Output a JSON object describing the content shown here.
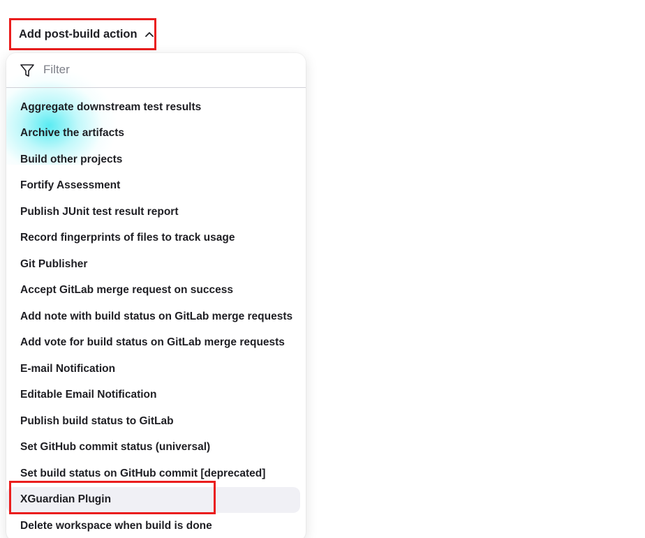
{
  "add_button": {
    "label": "Add post-build action",
    "icon": "chevron-up-icon"
  },
  "filter": {
    "placeholder": "Filter",
    "value": "",
    "icon": "filter-funnel-icon"
  },
  "menu_items": [
    {
      "label": "Aggregate downstream test results"
    },
    {
      "label": "Archive the artifacts"
    },
    {
      "label": "Build other projects"
    },
    {
      "label": "Fortify Assessment"
    },
    {
      "label": "Publish JUnit test result report"
    },
    {
      "label": "Record fingerprints of files to track usage"
    },
    {
      "label": "Git Publisher"
    },
    {
      "label": "Accept GitLab merge request on success"
    },
    {
      "label": "Add note with build status on GitLab merge requests"
    },
    {
      "label": "Add vote for build status on GitLab merge requests"
    },
    {
      "label": "E-mail Notification"
    },
    {
      "label": "Editable Email Notification"
    },
    {
      "label": "Publish build status to GitLab"
    },
    {
      "label": "Set GitHub commit status (universal)"
    },
    {
      "label": "Set build status on GitHub commit [deprecated]"
    },
    {
      "label": "XGuardian Plugin",
      "hovered": true
    },
    {
      "label": "Delete workspace when build is done"
    }
  ],
  "colors": {
    "highlight_border": "#ea1d1d",
    "hover_bg": "#f0f0f5",
    "text": "#1f1f24",
    "placeholder": "#7d7f88"
  }
}
